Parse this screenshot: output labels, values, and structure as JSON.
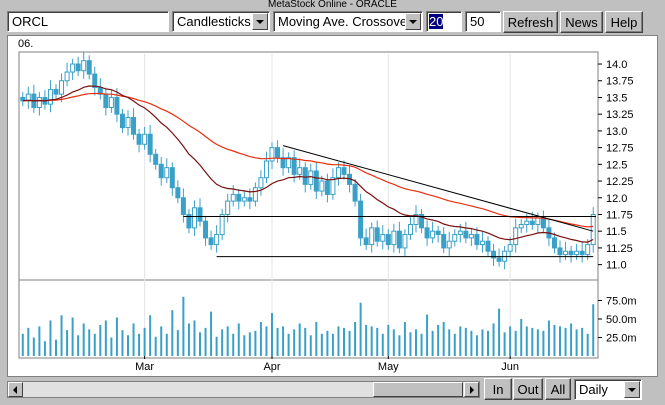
{
  "app": {
    "title": "MetaStock Online - ORACLE"
  },
  "toolbar": {
    "symbol_value": "ORCL",
    "chart_type": "Candlesticks",
    "indicator": "Moving Ave. Crossover",
    "period_short": "20",
    "period_long": "50",
    "refresh_label": "Refresh",
    "news_label": "News",
    "help_label": "Help"
  },
  "bottom": {
    "zoom_in_label": "In",
    "zoom_out_label": "Out",
    "all_label": "All",
    "interval": "Daily"
  },
  "colors": {
    "candle": "#3aa0c8",
    "ma_short": "#7a1010",
    "ma_long": "#e83010",
    "trendline": "#000000",
    "volume": "#3aa0c8"
  },
  "chart_data": {
    "type": "candlestick",
    "year_label": "06.",
    "price_axis": {
      "ticks": [
        14.0,
        13.75,
        13.5,
        13.25,
        13.0,
        12.75,
        12.5,
        12.25,
        12.0,
        11.75,
        11.5,
        11.25,
        11.0
      ],
      "range": [
        10.8,
        14.15
      ]
    },
    "volume_axis": {
      "ticks": [
        "75.0m",
        "50.0m",
        "25.0m"
      ],
      "tick_values": [
        75,
        50,
        25
      ],
      "range": [
        0,
        100
      ]
    },
    "month_labels": [
      {
        "label": "Mar",
        "index": 22
      },
      {
        "label": "Apr",
        "index": 45
      },
      {
        "label": "May",
        "index": 66
      },
      {
        "label": "Jun",
        "index": 88
      }
    ],
    "closes": [
      13.45,
      13.55,
      13.35,
      13.5,
      13.4,
      13.62,
      13.55,
      13.75,
      13.88,
      14.0,
      13.9,
      14.05,
      13.85,
      13.65,
      13.55,
      13.35,
      13.5,
      13.25,
      13.05,
      13.2,
      12.95,
      12.8,
      12.95,
      12.65,
      12.5,
      12.3,
      12.45,
      12.15,
      12.0,
      11.75,
      11.55,
      11.85,
      11.65,
      11.4,
      11.3,
      11.45,
      11.75,
      11.95,
      12.05,
      11.95,
      12.0,
      11.95,
      12.15,
      12.3,
      12.55,
      12.75,
      12.6,
      12.45,
      12.6,
      12.35,
      12.45,
      12.2,
      12.4,
      12.1,
      12.25,
      12.05,
      12.3,
      12.45,
      12.35,
      12.2,
      11.95,
      11.4,
      11.3,
      11.55,
      11.35,
      11.45,
      11.3,
      11.5,
      11.25,
      11.45,
      11.6,
      11.75,
      11.55,
      11.4,
      11.5,
      11.45,
      11.25,
      11.35,
      11.45,
      11.5,
      11.4,
      11.45,
      11.3,
      11.35,
      11.2,
      11.1,
      11.05,
      11.2,
      11.3,
      11.55,
      11.6,
      11.65,
      11.6,
      11.7,
      11.55,
      11.4,
      11.25,
      11.15,
      11.2,
      11.15,
      11.2,
      11.15,
      11.3,
      11.75
    ],
    "volumes": [
      30,
      38,
      25,
      40,
      20,
      48,
      22,
      55,
      35,
      52,
      28,
      44,
      36,
      30,
      42,
      48,
      25,
      52,
      35,
      28,
      44,
      30,
      38,
      55,
      26,
      40,
      30,
      62,
      35,
      80,
      44,
      48,
      32,
      38,
      60,
      26,
      36,
      40,
      30,
      44,
      28,
      32,
      34,
      46,
      40,
      58,
      38,
      40,
      30,
      36,
      44,
      38,
      28,
      46,
      30,
      34,
      30,
      40,
      38,
      34,
      46,
      72,
      42,
      40,
      38,
      30,
      42,
      36,
      28,
      46,
      32,
      36,
      30,
      56,
      34,
      42,
      46,
      36,
      30,
      40,
      38,
      34,
      28,
      36,
      34,
      44,
      64,
      32,
      40,
      34,
      50,
      40,
      38,
      36,
      34,
      48,
      42,
      40,
      38,
      44,
      36,
      38,
      30,
      70
    ]
  }
}
